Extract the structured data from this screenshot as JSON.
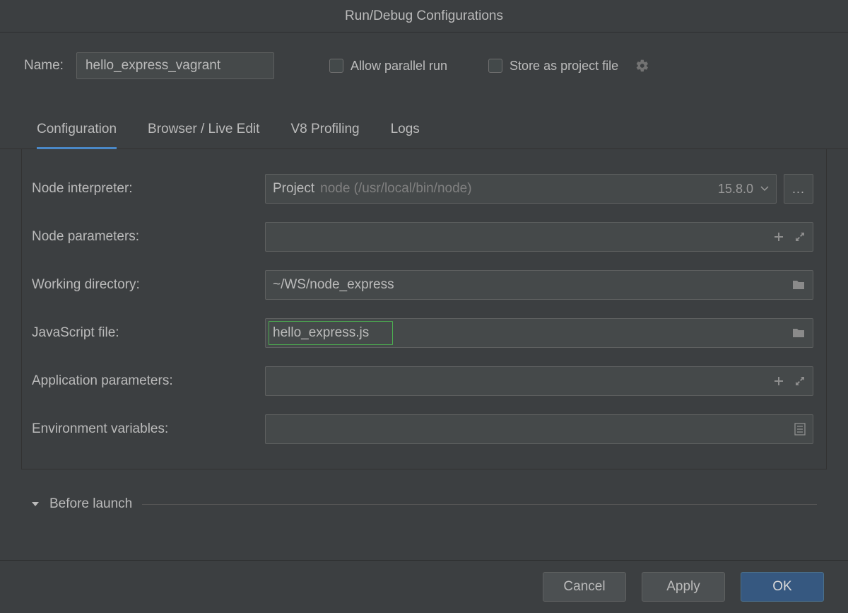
{
  "title": "Run/Debug Configurations",
  "header": {
    "name_label": "Name:",
    "name_value": "hello_express_vagrant",
    "allow_parallel": "Allow parallel run",
    "store_as_project": "Store as project file"
  },
  "tabs": [
    "Configuration",
    "Browser / Live Edit",
    "V8 Profiling",
    "Logs"
  ],
  "active_tab": 0,
  "fields": {
    "node_interpreter": {
      "label": "Node interpreter:",
      "prefix": "Project",
      "hint": "node (/usr/local/bin/node)",
      "version": "15.8.0"
    },
    "node_parameters": {
      "label": "Node parameters:",
      "value": ""
    },
    "working_dir": {
      "label": "Working directory:",
      "value": "~/WS/node_express"
    },
    "js_file": {
      "label": "JavaScript file:",
      "value": "hello_express.js"
    },
    "app_params": {
      "label": "Application parameters:",
      "value": ""
    },
    "env_vars": {
      "label": "Environment variables:",
      "value": ""
    }
  },
  "before_launch": "Before launch",
  "buttons": {
    "cancel": "Cancel",
    "apply": "Apply",
    "ok": "OK"
  },
  "ellipsis": "..."
}
